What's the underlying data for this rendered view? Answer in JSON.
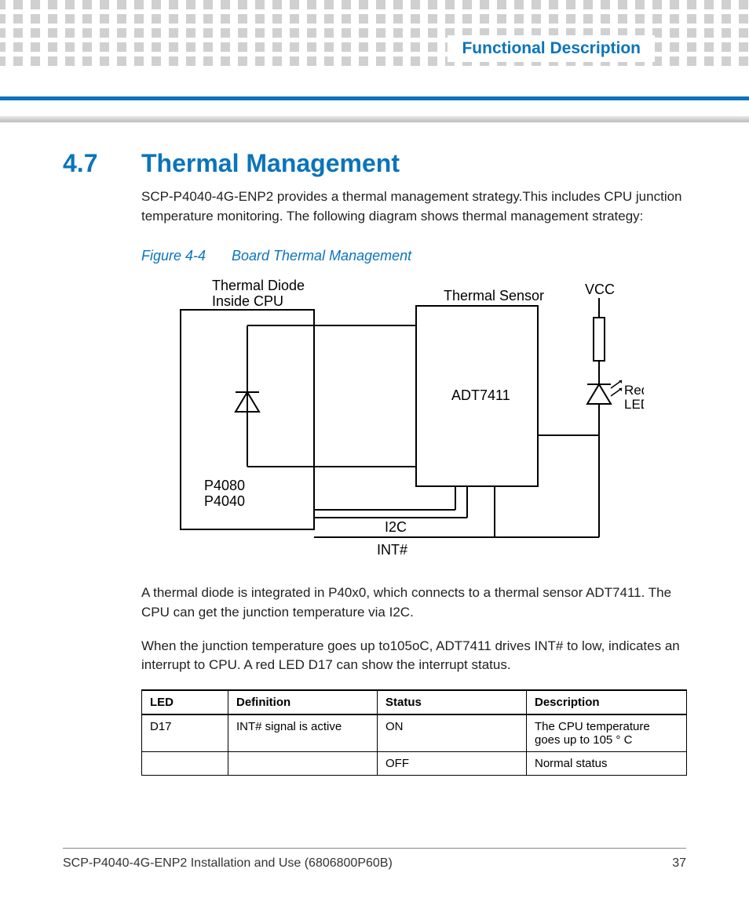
{
  "header": {
    "breadcrumb": "Functional Description"
  },
  "section": {
    "number": "4.7",
    "title": "Thermal Management",
    "intro": "SCP-P4040-4G-ENP2 provides a thermal management strategy.This includes CPU junction temperature monitoring. The following diagram shows thermal management strategy:",
    "figure_num": "Figure 4-4",
    "figure_title": "Board Thermal Management",
    "para2": "A thermal diode is integrated in P40x0, which connects to a thermal sensor ADT7411. The CPU can get the junction temperature via I2C.",
    "para3": "When the junction temperature goes up to105oC, ADT7411 drives INT# to low, indicates an interrupt to CPU. A red LED D17 can show the interrupt status."
  },
  "diagram": {
    "cpu_label1": "Thermal Diode",
    "cpu_label2": "Inside CPU",
    "cpu_part1": "P4080",
    "cpu_part2": "P4040",
    "sensor_label": "Thermal Sensor",
    "sensor_part": "ADT7411",
    "vcc": "VCC",
    "led_label1": "Red",
    "led_label2": "LED",
    "bus_i2c": "I2C",
    "bus_int": "INT#"
  },
  "table": {
    "headers": [
      "LED",
      "Definition",
      "Status",
      "Description"
    ],
    "rows": [
      [
        "D17",
        "INT# signal is active",
        "ON",
        "The CPU temperature goes up to 105 ° C"
      ],
      [
        "",
        "",
        "OFF",
        "Normal status"
      ]
    ]
  },
  "footer": {
    "doc": "SCP-P4040-4G-ENP2 Installation and Use (6806800P60B)",
    "page": "37"
  }
}
